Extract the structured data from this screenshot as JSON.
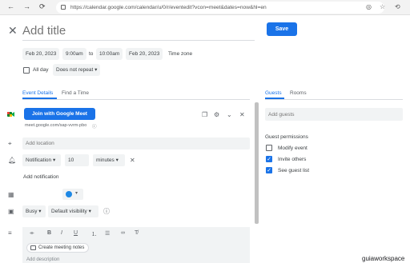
{
  "browser": {
    "url": "https://calendar.google.com/calendar/u/0/r/eventedit?vcon=meet&dates=now&hl=en"
  },
  "event": {
    "title_placeholder": "Add title",
    "save_label": "Save",
    "start_date": "Feb 20, 2023",
    "start_time": "9:00am",
    "to_label": "to",
    "end_time": "10:00am",
    "end_date": "Feb 20, 2023",
    "timezone_label": "Time zone",
    "all_day_label": "All day",
    "repeat_value": "Does not repeat"
  },
  "tabs": {
    "left": [
      "Event Details",
      "Find a Time"
    ],
    "right": [
      "Guests",
      "Rooms"
    ]
  },
  "details": {
    "meet_button": "Join with Google Meet",
    "meet_link": "meet.google.com/sap-vvrm-pbo",
    "location_placeholder": "Add location",
    "notification_type": "Notification",
    "notification_value": "10",
    "notification_unit": "minutes",
    "add_notification": "Add notification",
    "color": "#1e88e5",
    "availability": "Busy",
    "visibility": "Default visibility",
    "notes_button": "Create meeting notes",
    "description_placeholder": "Add description"
  },
  "guests": {
    "add_placeholder": "Add guests",
    "permissions_title": "Guest permissions",
    "permissions": [
      {
        "label": "Modify event",
        "checked": false
      },
      {
        "label": "Invite others",
        "checked": true
      },
      {
        "label": "See guest list",
        "checked": true
      }
    ]
  },
  "watermark": "guiaworkspace",
  "colors": {
    "accent": "#1a73e8",
    "field_bg": "#f1f3f4"
  }
}
